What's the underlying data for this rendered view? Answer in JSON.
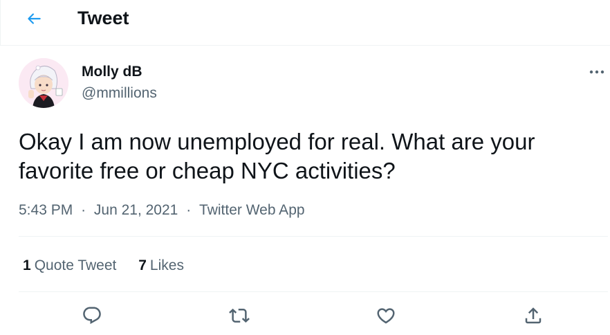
{
  "header": {
    "title": "Tweet",
    "back_icon": "arrow-left-icon"
  },
  "author": {
    "name": "Molly dB",
    "handle": "@mmillions",
    "avatar_icon": "anime-avatar"
  },
  "tweet": {
    "text": "Okay I am now unemployed for real. What are your favorite free or cheap NYC activities?",
    "time": "5:43 PM",
    "date": "Jun 21, 2021",
    "source": "Twitter Web App",
    "separator": "·"
  },
  "stats": {
    "quote_count": "1",
    "quote_label": "Quote Tweet",
    "likes_count": "7",
    "likes_label": "Likes"
  },
  "actions": [
    "reply-icon",
    "retweet-icon",
    "like-icon",
    "share-icon"
  ],
  "colors": {
    "accent": "#1d9bf0",
    "text_primary": "#0f1419",
    "text_secondary": "#536471",
    "divider": "#eff3f4"
  }
}
